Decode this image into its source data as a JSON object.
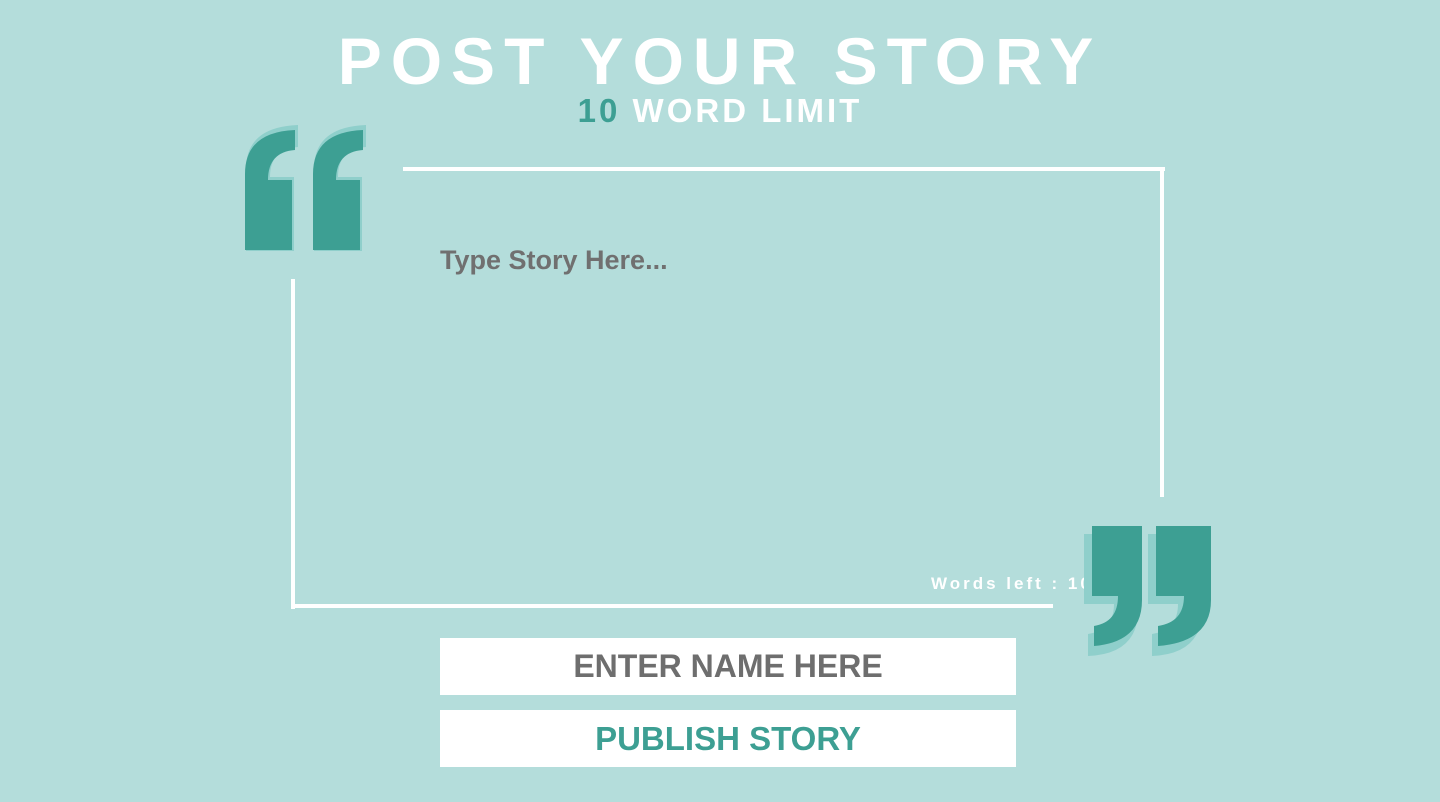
{
  "header": {
    "title": "POST YOUR STORY",
    "word_limit_number": "10",
    "word_limit_label": "WORD LIMIT"
  },
  "story": {
    "placeholder": "Type Story Here...",
    "value": "",
    "words_left_label": "Words left : ",
    "words_left_count": "10"
  },
  "name": {
    "placeholder": "ENTER NAME HERE",
    "value": ""
  },
  "publish": {
    "label": "PUBLISH STORY"
  },
  "icons": {
    "open_quote": "open-quote-icon",
    "close_quote": "close-quote-icon"
  },
  "colors": {
    "background": "#b4dddb",
    "accent": "#3d9f93",
    "accent_shadow": "#8fcfcb",
    "text_gray": "#707070",
    "white": "#ffffff"
  }
}
